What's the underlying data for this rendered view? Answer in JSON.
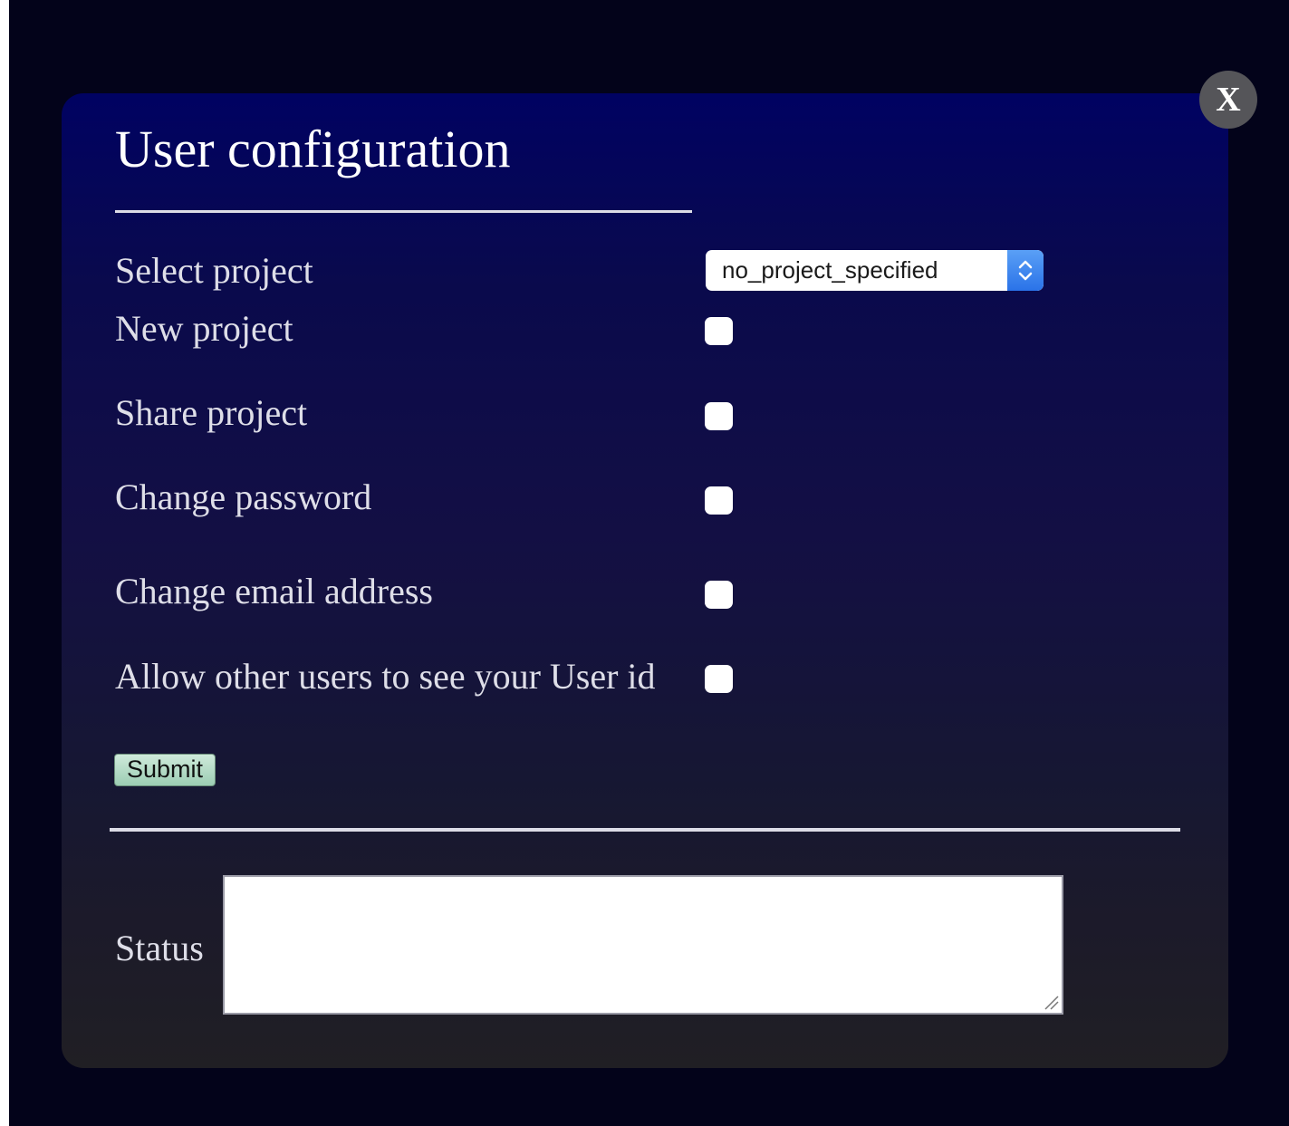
{
  "dialog": {
    "title": "User configuration",
    "close_label": "X"
  },
  "form": {
    "select_project": {
      "label": "Select project",
      "value": "no_project_specified"
    },
    "options": [
      {
        "label": "New project",
        "checked": false
      },
      {
        "label": "Share project",
        "checked": false
      },
      {
        "label": "Change password",
        "checked": false
      },
      {
        "label": "Change email address",
        "checked": false
      },
      {
        "label": "Allow other users to see your User id",
        "checked": false
      }
    ],
    "submit_label": "Submit"
  },
  "status": {
    "label": "Status",
    "value": ""
  }
}
